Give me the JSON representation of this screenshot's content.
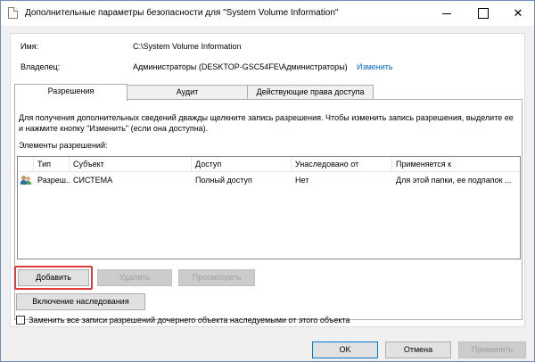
{
  "window": {
    "title": "Дополнительные параметры безопасности  для \"System Volume Information\"",
    "close_glyph": "✕"
  },
  "info": {
    "name_label": "Имя:",
    "name_value": "C:\\System Volume Information",
    "owner_label": "Владелец:",
    "owner_value": "Администраторы (DESKTOP-GSC54FE\\Администраторы)",
    "change_link": "Изменить"
  },
  "tabs": [
    {
      "label": "Разрешения",
      "active": true
    },
    {
      "label": "Аудит",
      "active": false
    },
    {
      "label": "Действующие права доступа",
      "active": false
    }
  ],
  "permissions": {
    "description": "Для получения дополнительных сведений дважды щелкните запись разрешения. Чтобы изменить запись разрешения, выделите ее и нажмите кнопку \"Изменить\" (если она доступна).",
    "list_label": "Элементы разрешений:",
    "columns": [
      "Тип",
      "Субъект",
      "Доступ",
      "Унаследовано от",
      "Применяется к"
    ],
    "rows": [
      {
        "icon": "users-icon",
        "type": "Разреш...",
        "principal": "СИСТЕМА",
        "access": "Полный доступ",
        "inherited": "Нет",
        "applies_to": "Для этой папки, ее подпапок ..."
      }
    ],
    "add_button": "Добавить",
    "remove_button": "Удалить",
    "view_button": "Просмотреть",
    "inheritance_button": "Включение наследования",
    "replace_checkbox_label": "Заменить все записи разрешений дочернего объекта наследуемыми от этого объекта",
    "replace_checked": false
  },
  "footer": {
    "ok": "OK",
    "cancel": "Отмена",
    "apply": "Применить"
  },
  "colors": {
    "link": "#0066cc",
    "highlight": "#e03a3a",
    "primary_border": "#0078d7"
  }
}
